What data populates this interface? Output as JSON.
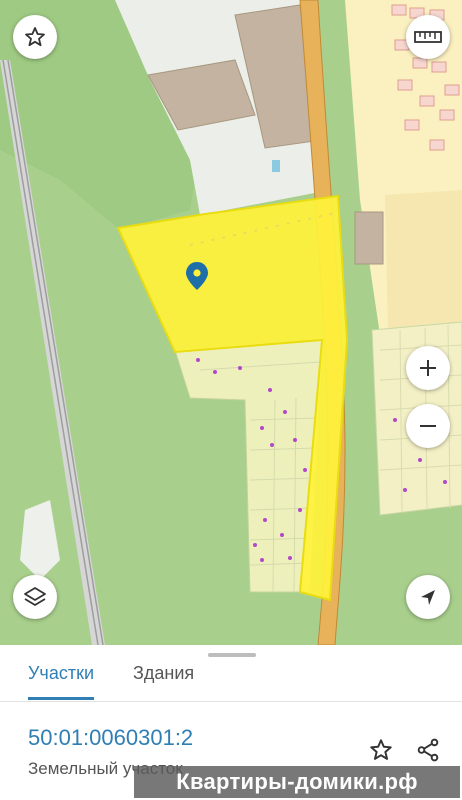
{
  "map": {
    "controls": {
      "favorite": "star-outline-icon",
      "ruler": "ruler-icon",
      "zoom_in": "plus-icon",
      "zoom_out": "minus-icon",
      "layers": "layers-icon",
      "my_location": "navigation-arrow-icon"
    },
    "colors": {
      "selected_parcel": "#fff23a",
      "marker": "#1e6fa8",
      "road": "#e2ae4e"
    }
  },
  "sheet": {
    "tabs": [
      {
        "label": "Участки",
        "active": true
      },
      {
        "label": "Здания",
        "active": false
      }
    ],
    "parcel": {
      "cadastral_number": "50:01:0060301:2",
      "type": "Земельный участок"
    },
    "actions": {
      "favorite": "star-outline-icon",
      "share": "share-icon"
    }
  },
  "watermark": {
    "text": "Квартиры-домики.рф"
  },
  "colors": {
    "accent": "#2f7fb5"
  }
}
